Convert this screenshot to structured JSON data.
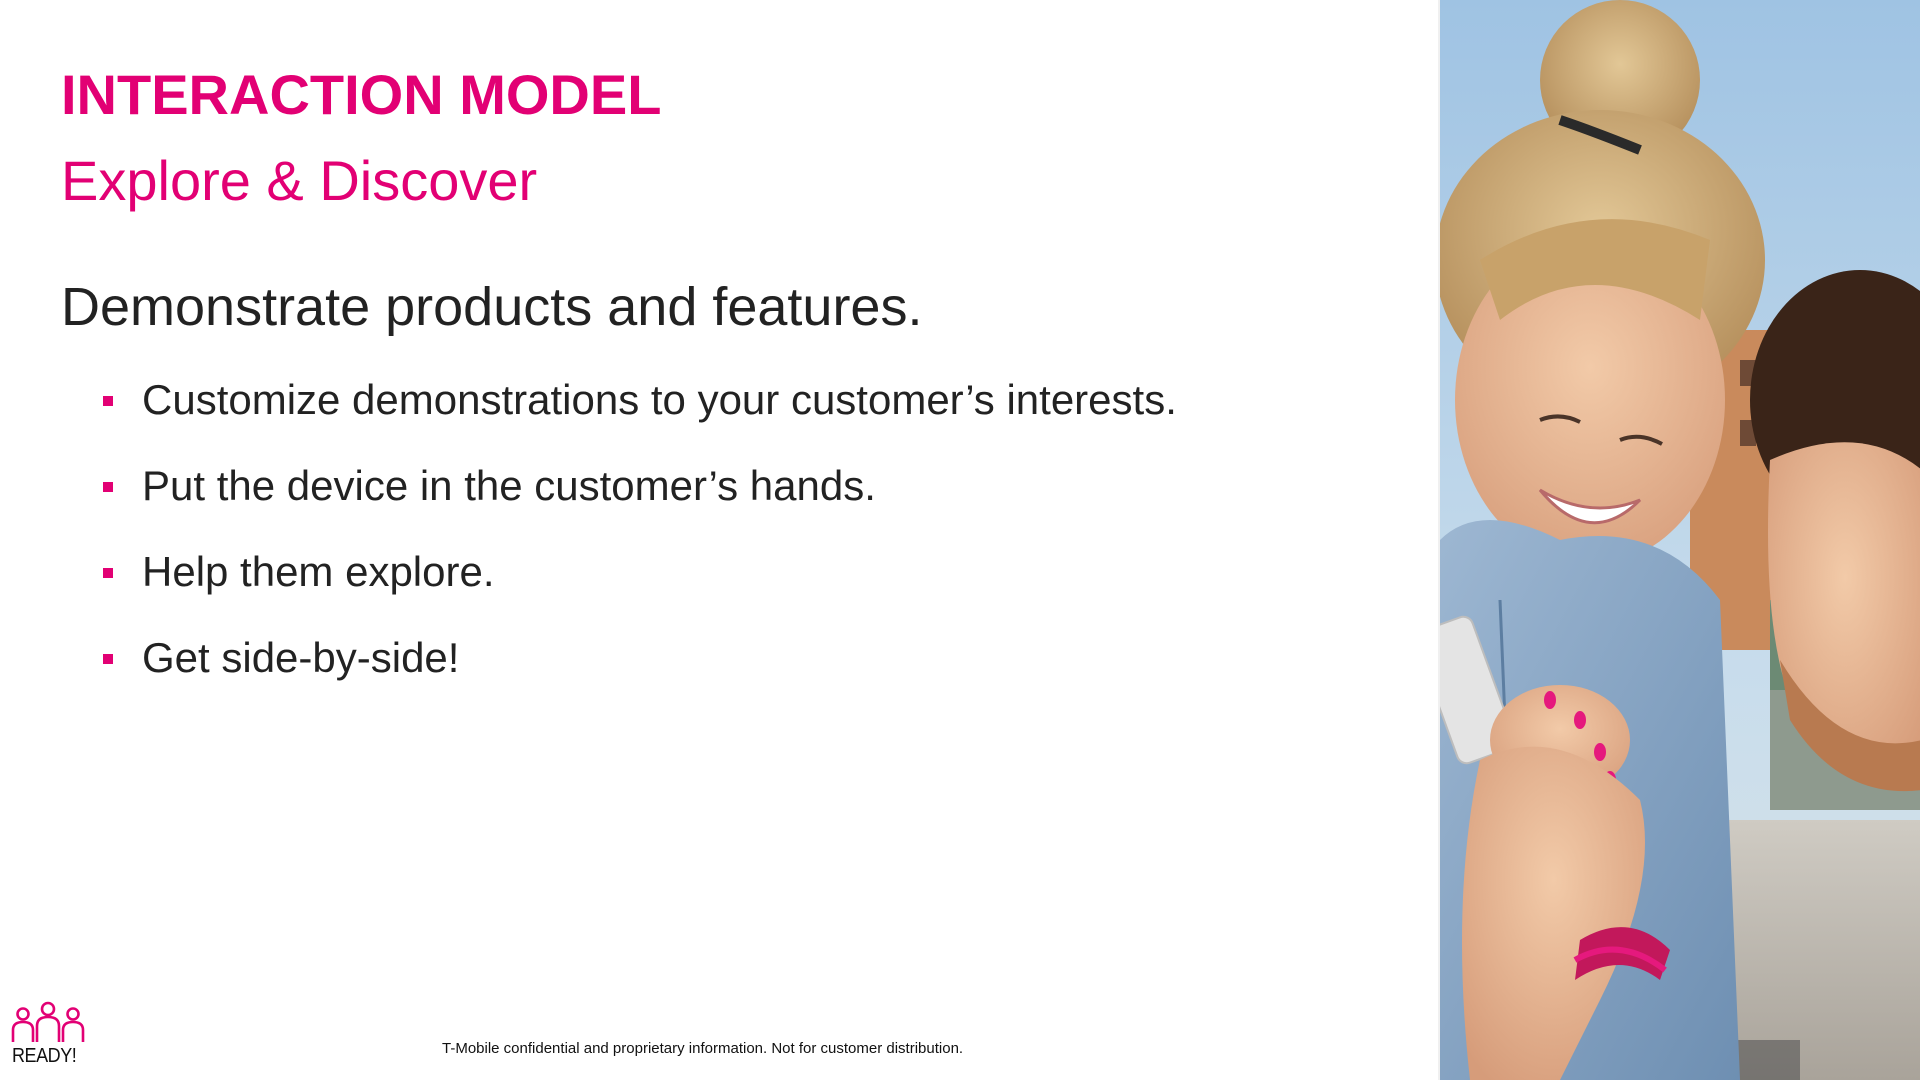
{
  "slide": {
    "title": "INTERACTION MODEL",
    "subtitle": "Explore & Discover",
    "lead": "Demonstrate products and features.",
    "bullets": [
      "Customize demonstrations to your customer’s interests.",
      "Put the device in the customer’s hands.",
      "Help them explore.",
      "Get side-by-side!"
    ],
    "footer_note": "T-Mobile confidential and proprietary information. Not for customer distribution.",
    "logo_text": "READY!"
  },
  "colors": {
    "brand_magenta": "#E20074",
    "body_text": "#222222",
    "background": "#FFFFFF"
  },
  "icons": {
    "logo": "ready-team-logo-icon",
    "bullet": "square-bullet-icon"
  }
}
